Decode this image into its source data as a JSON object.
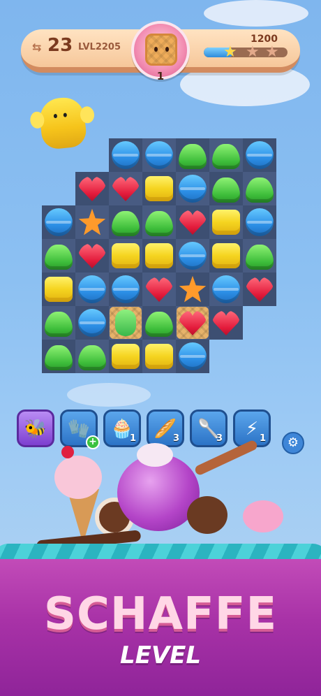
{
  "hud": {
    "moves_left": "23",
    "level": "LVL2205",
    "score_target": "1200",
    "goal_count": "1",
    "goal_icon": "waffle-cookie-icon",
    "moves_icon": "shuffle-arrows-icon",
    "progress": 0.35,
    "stars": [
      "star-icon",
      "star-icon",
      "star-icon"
    ]
  },
  "boosters": [
    {
      "icon": "bee-swarm-icon",
      "count": "",
      "selected": true
    },
    {
      "icon": "oven-mitt-icon",
      "count": "",
      "add": "+"
    },
    {
      "icon": "piping-bag-icon",
      "count": "1"
    },
    {
      "icon": "rolling-pin-icon",
      "count": "3"
    },
    {
      "icon": "spoon-icon",
      "count": "3"
    },
    {
      "icon": "lightning-bulb-icon",
      "count": "1"
    }
  ],
  "settings_icon": "gear-icon",
  "banner": {
    "title": "SCHAFFE",
    "subtitle": "LEVEL"
  },
  "colors": {
    "sky": "#8cc0f2",
    "banner": "#a832a7",
    "title": "#ffd7e6",
    "board": "#3d4f72"
  },
  "board": {
    "rows": [
      [
        null,
        null,
        "macaron",
        "macaron",
        "gumdrop",
        "gumdrop",
        "macaron"
      ],
      [
        null,
        "heart",
        "heart",
        "cake",
        "macaron",
        "gumdrop",
        "gumdrop"
      ],
      [
        "macaron",
        "star",
        "gumdrop",
        "gumdrop",
        "heart",
        "cake",
        "macaron"
      ],
      [
        "gumdrop",
        "heart",
        "cake",
        "cake",
        "macaron",
        "cake",
        "gumdrop"
      ],
      [
        "cake",
        "macaron",
        "macaron",
        "heart",
        "star",
        "macaron",
        "heart"
      ],
      [
        "gumdrop",
        "macaron",
        "jelly-waffle",
        "gumdrop",
        "heart-waffle",
        "heart",
        null
      ],
      [
        "gumdrop",
        "gumdrop",
        "cake",
        "cake",
        "macaron",
        null,
        null
      ]
    ]
  }
}
